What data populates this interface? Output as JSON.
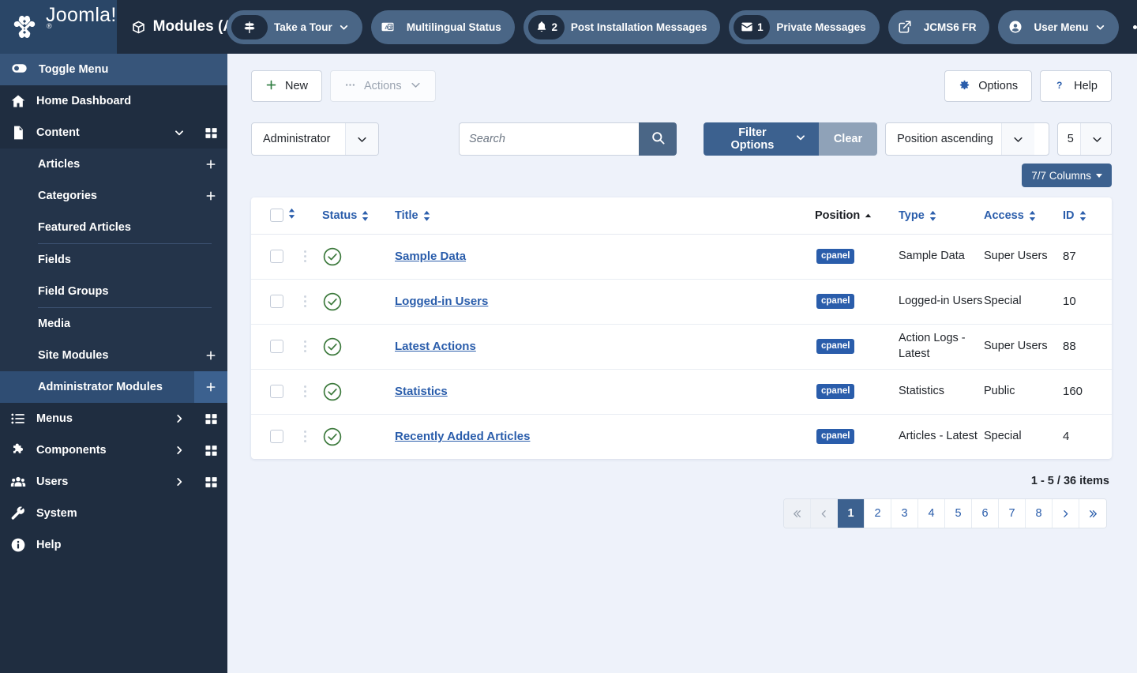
{
  "brand": {
    "name": "Joomla!",
    "trademark": "®",
    "logo_icon": "joomla-logo-icon"
  },
  "header": {
    "page_title": "Modules (A",
    "page_title_icon": "cube-icon",
    "pills": [
      {
        "label": "Take a Tour",
        "icon": "signpost-icon",
        "has_chevron": true
      },
      {
        "label": "Multilingual Status",
        "icon": "translate-icon",
        "has_chevron": false
      },
      {
        "label": "Post Installation Messages",
        "icon": "bell-icon",
        "count": "2",
        "has_chevron": false
      },
      {
        "label": "Private Messages",
        "icon": "envelope-icon",
        "count": "1",
        "has_chevron": false
      },
      {
        "label": "JCMS6 FR",
        "icon": "external-link-icon",
        "has_chevron": false
      },
      {
        "label": "User Menu",
        "icon": "user-circle-icon",
        "has_chevron": true
      }
    ],
    "more_button": "options-dots-icon"
  },
  "sidebar": {
    "toggle": {
      "label": "Toggle Menu",
      "icon": "toggle-icon"
    },
    "items": [
      {
        "label": "Home Dashboard",
        "icon": "home-icon",
        "arrow": null,
        "grid": false
      },
      {
        "label": "Content",
        "icon": "document-icon",
        "arrow": "chevron-down",
        "grid": true
      }
    ],
    "content_children": [
      {
        "label": "Articles",
        "plus": true,
        "divider_after": false,
        "active": false
      },
      {
        "label": "Categories",
        "plus": true,
        "divider_after": false,
        "active": false
      },
      {
        "label": "Featured Articles",
        "plus": false,
        "divider_after": true,
        "active": false
      },
      {
        "label": "Fields",
        "plus": false,
        "divider_after": false,
        "active": false
      },
      {
        "label": "Field Groups",
        "plus": false,
        "divider_after": true,
        "active": false
      },
      {
        "label": "Media",
        "plus": false,
        "divider_after": false,
        "active": false
      },
      {
        "label": "Site Modules",
        "plus": true,
        "divider_after": false,
        "active": false
      },
      {
        "label": "Administrator Modules",
        "plus": true,
        "divider_after": false,
        "active": true
      }
    ],
    "items_bottom": [
      {
        "label": "Menus",
        "icon": "list-icon",
        "arrow": "chevron-right",
        "grid": true
      },
      {
        "label": "Components",
        "icon": "puzzle-icon",
        "arrow": "chevron-right",
        "grid": true
      },
      {
        "label": "Users",
        "icon": "users-icon",
        "arrow": "chevron-right",
        "grid": true
      },
      {
        "label": "System",
        "icon": "wrench-icon",
        "arrow": null,
        "grid": false
      },
      {
        "label": "Help",
        "icon": "info-icon",
        "arrow": null,
        "grid": false
      }
    ]
  },
  "toolbar": {
    "new_label": "New",
    "new_icon": "plus-icon",
    "actions_label": "Actions",
    "actions_icon": "ellipsis-icon",
    "actions_disabled": true,
    "options_label": "Options",
    "options_icon": "gear-icon",
    "help_label": "Help",
    "help_icon": "question-icon"
  },
  "filters": {
    "client_select": "Administrator",
    "search_placeholder": "Search",
    "search_value": "",
    "search_icon": "search-icon",
    "filter_options_label": "Filter Options",
    "clear_label": "Clear",
    "sort_select": "Position ascending",
    "limit_select": "5",
    "columns_label": "7/7 Columns"
  },
  "table": {
    "columns": [
      {
        "key": "check",
        "label": "",
        "sortable": false
      },
      {
        "key": "ordering",
        "label": "",
        "sortable": true
      },
      {
        "key": "status",
        "label": "Status",
        "sortable": true
      },
      {
        "key": "title",
        "label": "Title",
        "sortable": true
      },
      {
        "key": "position",
        "label": "Position",
        "sortable": true,
        "active": true,
        "direction": "asc"
      },
      {
        "key": "type",
        "label": "Type",
        "sortable": true
      },
      {
        "key": "access",
        "label": "Access",
        "sortable": true
      },
      {
        "key": "id",
        "label": "ID",
        "sortable": true
      }
    ],
    "rows": [
      {
        "status": "published",
        "title": "Sample Data",
        "position": "cpanel",
        "type": "Sample Data",
        "access": "Super Users",
        "id": "87"
      },
      {
        "status": "published",
        "title": "Logged-in Users",
        "position": "cpanel",
        "type": "Logged-in Users",
        "access": "Special",
        "id": "10"
      },
      {
        "status": "published",
        "title": "Latest Actions",
        "position": "cpanel",
        "type": "Action Logs - Latest",
        "access": "Super Users",
        "id": "88"
      },
      {
        "status": "published",
        "title": "Statistics",
        "position": "cpanel",
        "type": "Statistics",
        "access": "Public",
        "id": "160"
      },
      {
        "status": "published",
        "title": "Recently Added Articles",
        "position": "cpanel",
        "type": "Articles - Latest",
        "access": "Special",
        "id": "4"
      }
    ]
  },
  "footer": {
    "counter": "1 - 5 / 36 items",
    "pages": [
      "1",
      "2",
      "3",
      "4",
      "5",
      "6",
      "7",
      "8"
    ],
    "current_page": "1",
    "first_icon": "double-chevron-left-icon",
    "prev_icon": "chevron-left-icon",
    "next_icon": "chevron-right-icon",
    "last_icon": "double-chevron-right-icon"
  },
  "colors": {
    "brand_navy": "#2a4667",
    "topbar_navy": "#1f2d40",
    "sidebar_navy": "#1f2d40",
    "accent_blue": "#3c618f",
    "link_blue": "#2a5dab",
    "status_green": "#3d7a3d",
    "page_bg": "#eef2fa"
  }
}
